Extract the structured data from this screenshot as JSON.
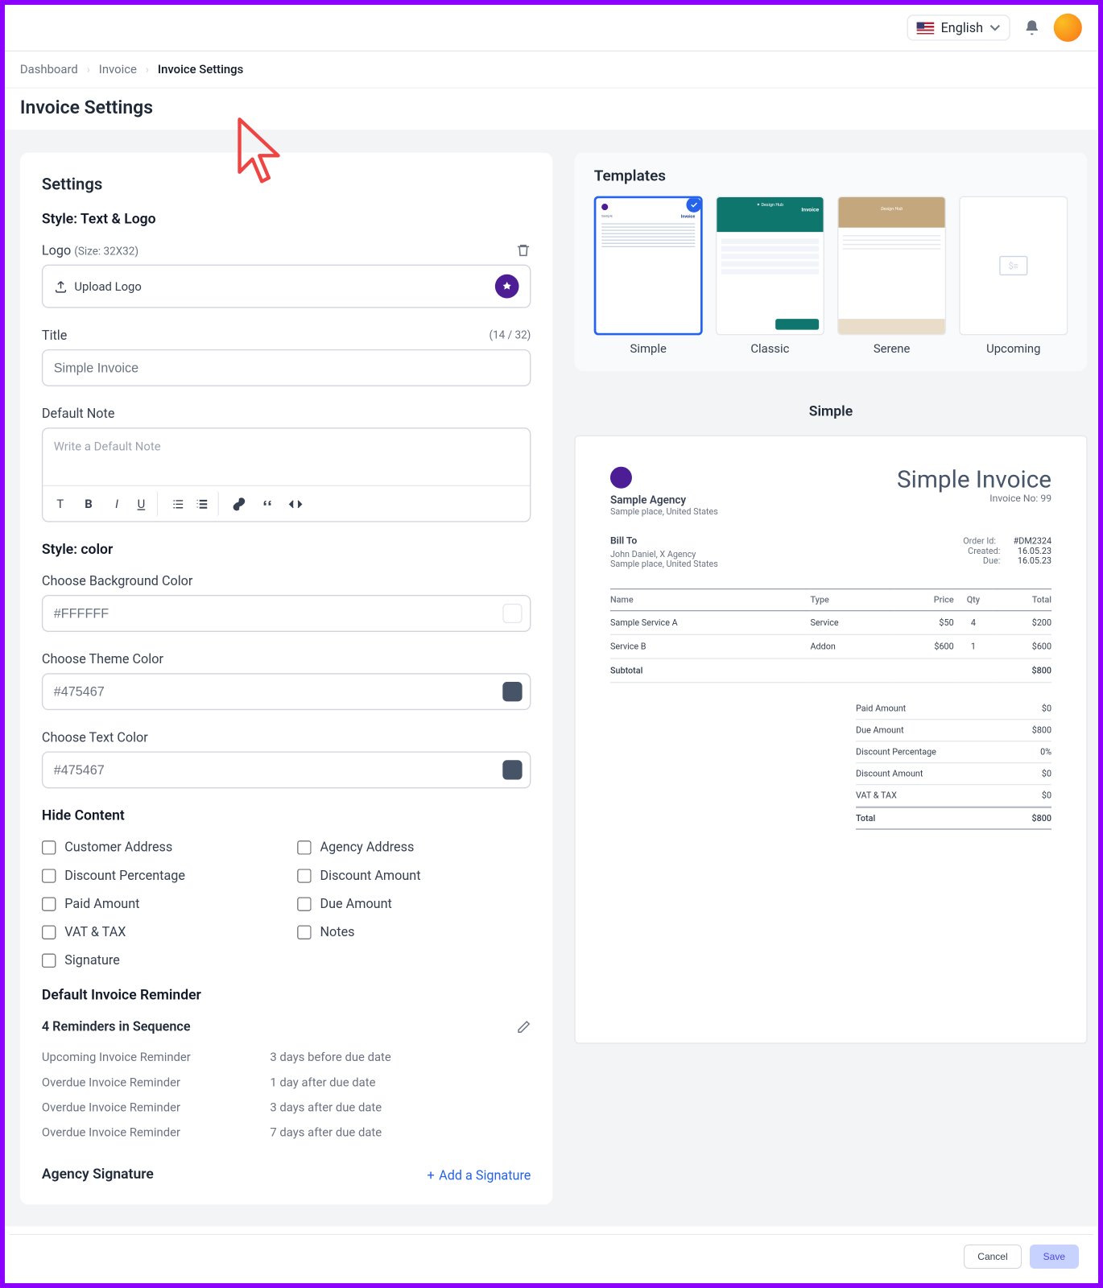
{
  "topbar": {
    "language": "English"
  },
  "breadcrumb": {
    "items": [
      "Dashboard",
      "Invoice",
      "Invoice Settings"
    ]
  },
  "page_title": "Invoice Settings",
  "settings": {
    "title": "Settings",
    "style_text_logo": "Style: Text & Logo",
    "logo_label": "Logo",
    "logo_hint": "(Size: 32X32)",
    "upload_label": "Upload Logo",
    "title_label": "Title",
    "title_counter": "(14 / 32)",
    "title_value": "Simple Invoice",
    "note_label": "Default Note",
    "note_placeholder": "Write a Default Note",
    "style_color": "Style: color",
    "bg_label": "Choose Background Color",
    "bg_value": "#FFFFFF",
    "theme_label": "Choose Theme Color",
    "theme_value": "#475467",
    "text_label": "Choose Text Color",
    "text_value": "#475467",
    "hide_title": "Hide Content",
    "hide_items": {
      "customer_address": "Customer Address",
      "agency_address": "Agency Address",
      "discount_percentage": "Discount Percentage",
      "discount_amount": "Discount Amount",
      "paid_amount": "Paid Amount",
      "due_amount": "Due Amount",
      "vat_tax": "VAT & TAX",
      "notes": "Notes",
      "signature": "Signature"
    },
    "reminder_title": "Default Invoice Reminder",
    "reminder_count": "4 Reminders in Sequence",
    "reminders": [
      {
        "label": "Upcoming Invoice Reminder",
        "when": "3 days before due date"
      },
      {
        "label": "Overdue Invoice Reminder",
        "when": "1 day after due date"
      },
      {
        "label": "Overdue Invoice Reminder",
        "when": "3 days after due date"
      },
      {
        "label": "Overdue Invoice Reminder",
        "when": "7 days after due date"
      }
    ],
    "signature_title": "Agency Signature",
    "add_signature": "Add a Signature"
  },
  "templates": {
    "title": "Templates",
    "items": [
      "Simple",
      "Classic",
      "Serene",
      "Upcoming"
    ]
  },
  "preview": {
    "template_name": "Simple",
    "agency": "Sample Agency",
    "agency_addr": "Sample place, United States",
    "invoice_title": "Simple Invoice",
    "invoice_no_label": "Invoice No: 99",
    "bill_to": "Bill To",
    "bill_name": "John Daniel, X Agency",
    "bill_addr": "Sample place, United States",
    "meta": {
      "order_id_k": "Order Id:",
      "order_id_v": "#DM2324",
      "created_k": "Created:",
      "created_v": "16.05.23",
      "due_k": "Due:",
      "due_v": "16.05.23"
    },
    "cols": {
      "name": "Name",
      "type": "Type",
      "price": "Price",
      "qty": "Qty",
      "total": "Total"
    },
    "items": [
      {
        "name": "Sample Service A",
        "type": "Service",
        "price": "$50",
        "qty": "4",
        "total": "$200"
      },
      {
        "name": "Service B",
        "type": "Addon",
        "price": "$600",
        "qty": "1",
        "total": "$600"
      }
    ],
    "subtotal_label": "Subtotal",
    "subtotal_value": "$800",
    "summary": [
      {
        "k": "Paid Amount",
        "v": "$0"
      },
      {
        "k": "Due Amount",
        "v": "$800"
      },
      {
        "k": "Discount Percentage",
        "v": "0%"
      },
      {
        "k": "Discount Amount",
        "v": "$0"
      },
      {
        "k": "VAT & TAX",
        "v": "$0"
      }
    ],
    "total_label": "Total",
    "total_value": "$800"
  },
  "footer": {
    "cancel": "Cancel",
    "save": "Save"
  },
  "colors": {
    "theme": "#475467",
    "text": "#475467",
    "bg": "#FFFFFF"
  }
}
